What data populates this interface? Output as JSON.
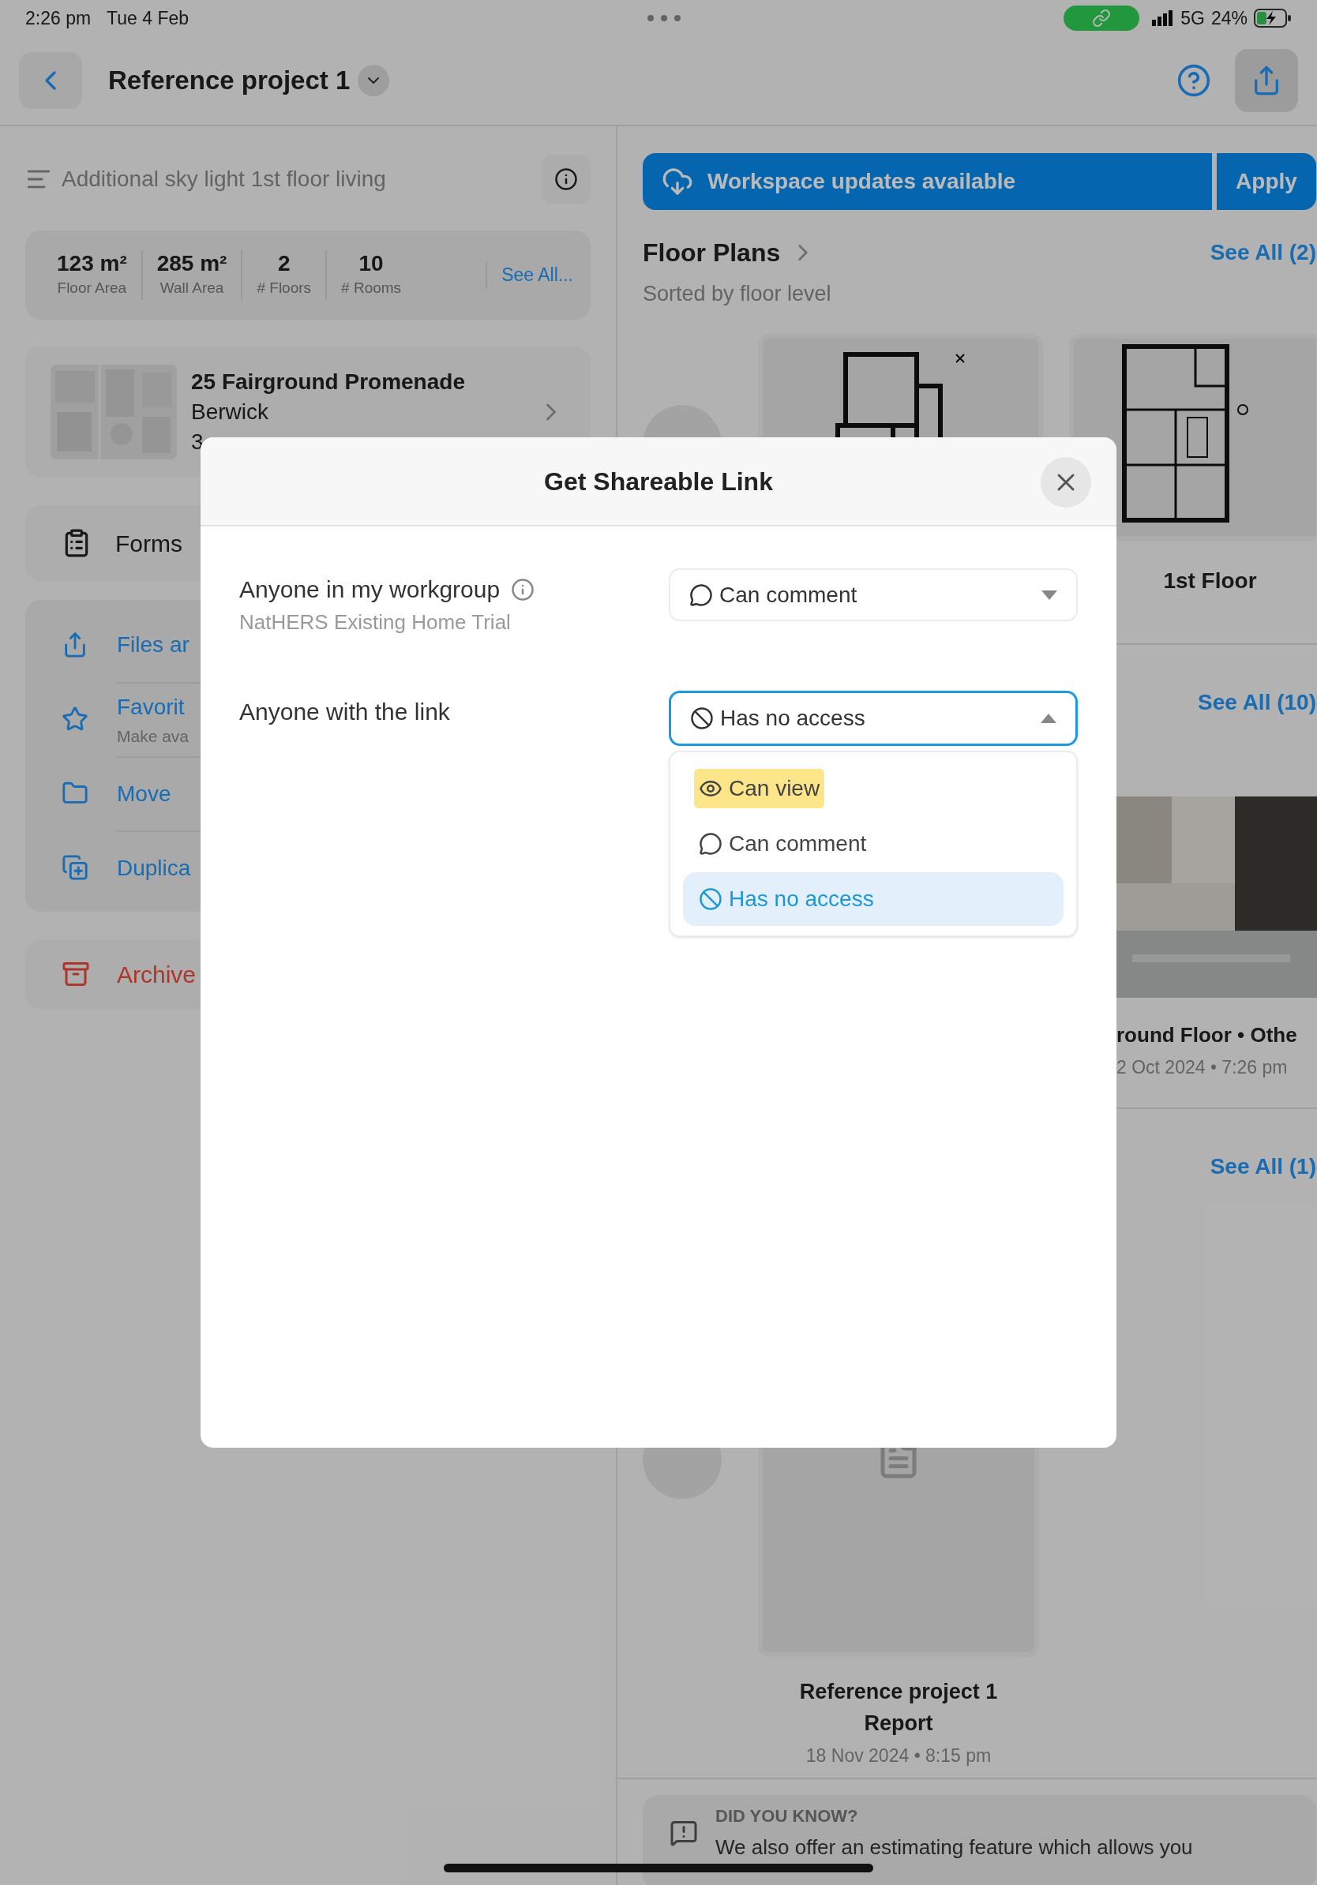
{
  "status_bar": {
    "time": "2:26 pm",
    "date": "Tue 4 Feb",
    "network": "5G",
    "battery": "24%"
  },
  "header": {
    "title": "Reference project 1"
  },
  "left_panel": {
    "description": "Additional sky light 1st floor living",
    "stats": [
      {
        "value": "123 m²",
        "label": "Floor Area"
      },
      {
        "value": "285 m²",
        "label": "Wall Area"
      },
      {
        "value": "2",
        "label": "# Floors"
      },
      {
        "value": "10",
        "label": "# Rooms"
      }
    ],
    "see_all": "See All...",
    "address": {
      "street": "25 Fairground Promenade",
      "suburb": "Berwick",
      "postcode": "3"
    },
    "forms": "Forms",
    "actions": [
      {
        "kind": "files",
        "label": "Files ar"
      },
      {
        "kind": "favorite",
        "label": "Favorit",
        "subtitle": "Make ava"
      },
      {
        "kind": "move",
        "label": "Move"
      },
      {
        "kind": "duplicate",
        "label": "Duplica"
      }
    ],
    "archive": "Archive"
  },
  "right_panel": {
    "banner": {
      "text": "Workspace updates available",
      "button": "Apply"
    },
    "floor_plans": {
      "title": "Floor Plans",
      "subtitle": "Sorted by floor level",
      "see_all": "See All (2)",
      "cards": [
        {
          "title": "1st Floor"
        }
      ]
    },
    "photos": {
      "see_all": "See All (10)",
      "caption": "round Floor • Othe",
      "date": "2 Oct 2024 • 7:26 pm"
    },
    "reports": {
      "see_all": "See All (1)",
      "title": "Reference project 1 Report",
      "date": "18 Nov 2024 • 8:15 pm"
    },
    "tip": {
      "heading": "DID YOU KNOW?",
      "text": "We also offer an estimating feature which allows you"
    }
  },
  "modal": {
    "title": "Get Shareable Link",
    "rows": [
      {
        "label": "Anyone in my workgroup",
        "sublabel": "NatHERS Existing Home Trial",
        "info": true,
        "value": {
          "kind": "comment",
          "label": "Can comment"
        },
        "expanded": false
      },
      {
        "label": "Anyone with the link",
        "info": false,
        "value": {
          "kind": "none",
          "label": "Has no access"
        },
        "expanded": true,
        "options": [
          {
            "kind": "view",
            "label": "Can view",
            "selected": false,
            "highlighted": true
          },
          {
            "kind": "comment",
            "label": "Can comment",
            "selected": false,
            "highlighted": false
          },
          {
            "kind": "none",
            "label": "Has no access",
            "selected": true,
            "highlighted": false
          }
        ]
      }
    ]
  }
}
